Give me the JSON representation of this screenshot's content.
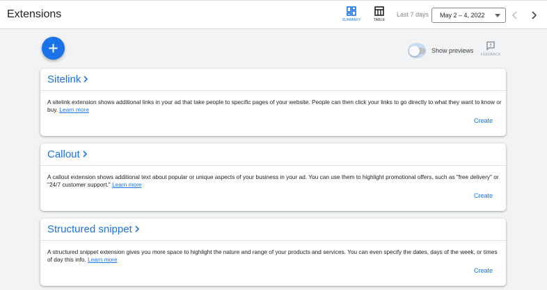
{
  "header": {
    "title": "Extensions",
    "views": [
      {
        "label": "SUMMARY",
        "icon": "summary-view-icon",
        "selected": true
      },
      {
        "label": "TABLE",
        "icon": "table-view-icon",
        "selected": false
      }
    ],
    "date_range_label": "Last 7 days",
    "date_range_value": "May 2 – 4, 2022"
  },
  "toolbar": {
    "show_previews_label": "Show previews",
    "show_previews_on": false,
    "feedback_label": "FEEDBACK"
  },
  "cards": [
    {
      "title": "Sitelink",
      "description": "A sitelink extension shows additional links in your ad that take people to specific pages of your website. People can then click your links to go directly to what they want to know or buy.",
      "learn_more": "Learn more",
      "action": "Create"
    },
    {
      "title": "Callout",
      "description": "A callout extension shows additional text about popular or unique aspects of your business in your ad. You can use them to highlight promotional offers, such as \"free delivery\" or \"24/7 customer support.\"",
      "learn_more": "Learn more",
      "action": "Create"
    },
    {
      "title": "Structured snippet",
      "description": "A structured snippet extension gives you more space to highlight the nature and range of your products and services. You can even specify the dates, days of the week, or times of day this info.",
      "learn_more": "Learn more",
      "action": "Create"
    }
  ],
  "colors": {
    "accent": "#1a73e8",
    "background": "#f1f3f4",
    "card": "#ffffff"
  }
}
